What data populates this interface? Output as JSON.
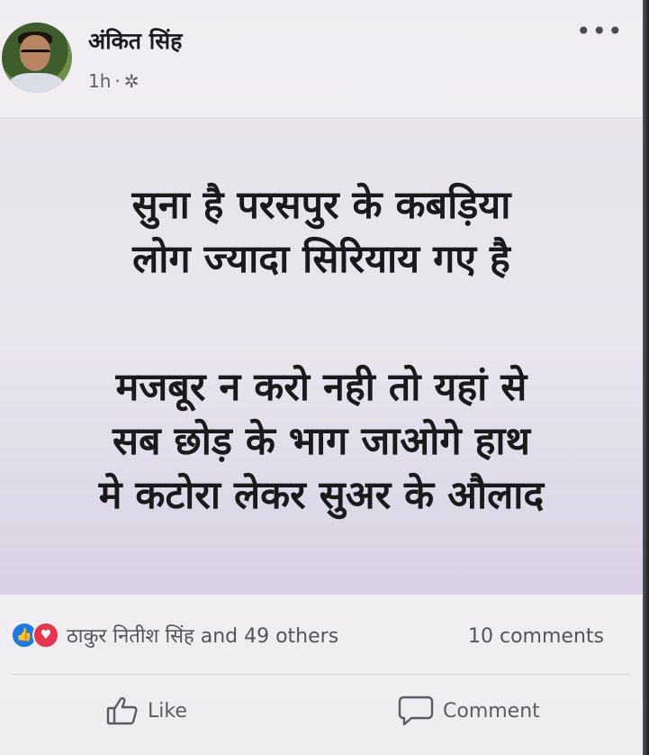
{
  "post": {
    "author": "अंकित सिंह",
    "time": "1h",
    "separator": "·",
    "audience_icon": "gear-icon",
    "more_icon": "•••",
    "image_text": {
      "para1": [
        "सुना है परसपुर के कबड़िया",
        "लोग ज्यादा सिरियाय गए है"
      ],
      "para2": [
        "मजबूर न करो नही तो यहां से",
        "सब छोड़ के भाग जाओगे हाथ",
        "मे कटोरा लेकर सुअर के औलाद"
      ]
    }
  },
  "reactions": {
    "summary": "ठाकुर नितीश सिंह and 49 others",
    "comments": "10 comments",
    "icons": [
      "like-reaction-icon",
      "love-reaction-icon"
    ],
    "colors": {
      "like": "#1b7ae8",
      "love": "#e8344d"
    }
  },
  "actions": {
    "like": "Like",
    "comment": "Comment"
  }
}
